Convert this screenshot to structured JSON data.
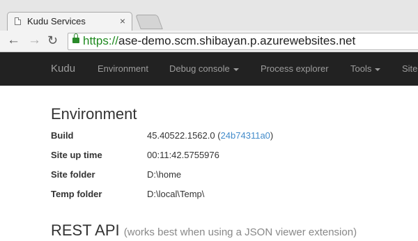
{
  "browser": {
    "tab_title": "Kudu Services",
    "tab_close": "×",
    "url_scheme": "https://",
    "url_rest": "ase-demo.scm.shibayan.p.azurewebsites.net"
  },
  "navbar": {
    "brand": "Kudu",
    "items": [
      "Environment",
      "Debug console",
      "Process explorer",
      "Tools",
      "Site"
    ]
  },
  "environment": {
    "title": "Environment",
    "rows": [
      {
        "label": "Build",
        "value": "45.40522.1562.0",
        "link": "24b74311a0"
      },
      {
        "label": "Site up time",
        "value": "00:11:42.5755976"
      },
      {
        "label": "Site folder",
        "value": "D:\\home"
      },
      {
        "label": "Temp folder",
        "value": "D:\\local\\Temp\\"
      }
    ]
  },
  "rest_api": {
    "title": "REST API",
    "note": "(works best when using a JSON viewer extension)"
  }
}
